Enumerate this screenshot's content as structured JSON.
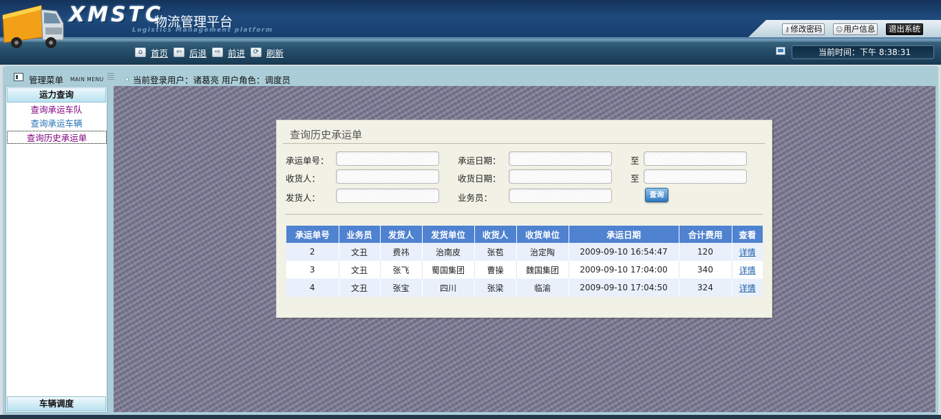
{
  "header": {
    "brand": "XMSTC",
    "title_cn": "物流管理平台",
    "subtitle_en": "Logistics Management platform",
    "buttons": {
      "change_password": "修改密码",
      "user_info": "用户信息",
      "logout": "退出系统"
    }
  },
  "nav": {
    "items": [
      {
        "label": "首页",
        "icon": "home-icon"
      },
      {
        "label": "后退",
        "icon": "back-arrow-icon"
      },
      {
        "label": "前进",
        "icon": "forward-arrow-icon"
      },
      {
        "label": "刷新",
        "icon": "refresh-icon"
      }
    ],
    "time_text": "当前时间：下午 8:38:31"
  },
  "sidebar": {
    "title": "管理菜单",
    "title_en": "MAIN MENU",
    "section_top": "运力查询",
    "links": [
      "查询承运车队",
      "查询承运车辆",
      "查询历史承运单"
    ],
    "section_bottom": "车辆调度"
  },
  "user_bar": {
    "text": "当前登录用户：诸葛亮 用户角色：调度员"
  },
  "panel": {
    "title": "查询历史承运单",
    "fields": {
      "carrier_no_label": "承运单号：",
      "carrier_date_label": "承运日期：",
      "to_label_1": "至",
      "receiver_label": "收货人：",
      "receive_date_label": "收货日期：",
      "to_label_2": "至",
      "sender_label": "发货人：",
      "salesman_label": "业务员："
    },
    "query_button": "查询"
  },
  "table": {
    "headers": [
      "承运单号",
      "业务员",
      "发货人",
      "发货单位",
      "收货人",
      "收货单位",
      "承运日期",
      "合计费用",
      "查看"
    ],
    "rows": [
      [
        "2",
        "文丑",
        "费祎",
        "治南皮",
        "张苞",
        "治定陶",
        "2009-09-10 16:54:47",
        "120",
        "详情"
      ],
      [
        "3",
        "文丑",
        "张飞",
        "蜀国集团",
        "曹操",
        "魏国集团",
        "2009-09-10 17:04:00",
        "340",
        "详情"
      ],
      [
        "4",
        "文丑",
        "张宝",
        "四川",
        "张梁",
        "临渝",
        "2009-09-10 17:04:50",
        "324",
        "详情"
      ]
    ]
  },
  "colors": {
    "header_dark": "#14335b",
    "table_header": "#4f82d0",
    "row_alt": "#e9f0fb",
    "content_texture": "#7d7b96",
    "panel_bg": "#f1f1e6"
  }
}
